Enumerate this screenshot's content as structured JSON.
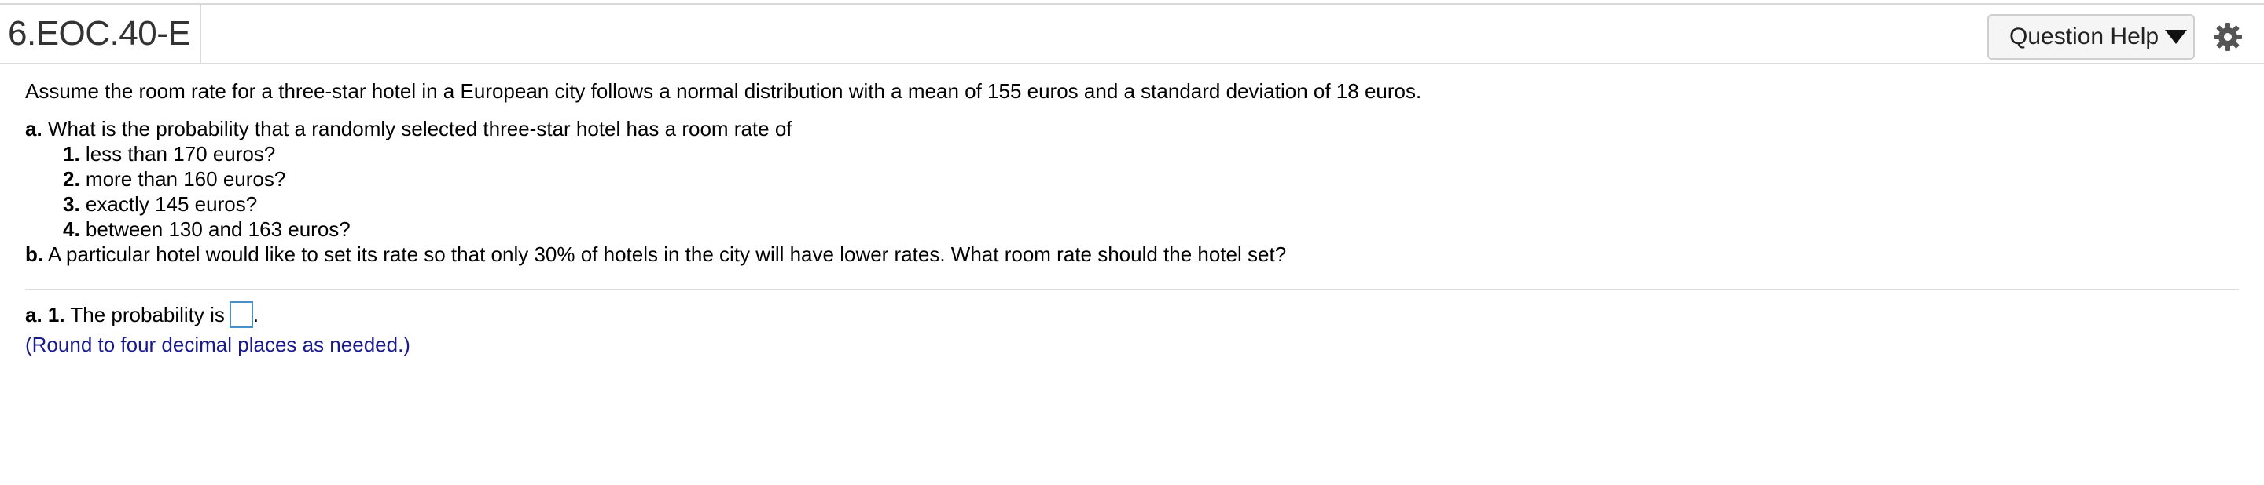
{
  "header": {
    "question_id": "6.EOC.40-E",
    "help_label": "Question Help",
    "help_caret_icon": "caret-down-icon",
    "settings_icon": "gear-icon"
  },
  "question": {
    "intro": "Assume the room rate for a three-star hotel in a European city follows a normal distribution with a mean of 155 euros and a standard deviation of 18 euros.",
    "part_a": {
      "label": "a.",
      "text": "What is the probability that a randomly selected three-star hotel has a room rate of",
      "items": [
        {
          "num": "1.",
          "text": "less than 170 euros?"
        },
        {
          "num": "2.",
          "text": "more than 160 euros?"
        },
        {
          "num": "3.",
          "text": "exactly 145 euros?"
        },
        {
          "num": "4.",
          "text": "between 130 and 163 euros?"
        }
      ]
    },
    "part_b": {
      "label": "b.",
      "text": "A particular hotel would like to set its rate so that only 30% of hotels in the city will have lower rates. What room rate should the hotel set?"
    }
  },
  "answer": {
    "label": "a. 1.",
    "prompt": "The probability is",
    "value": "",
    "suffix": ".",
    "hint": "(Round to four decimal places as needed.)",
    "box_color": "#4a90c8",
    "hint_color": "#1a1a8c"
  }
}
